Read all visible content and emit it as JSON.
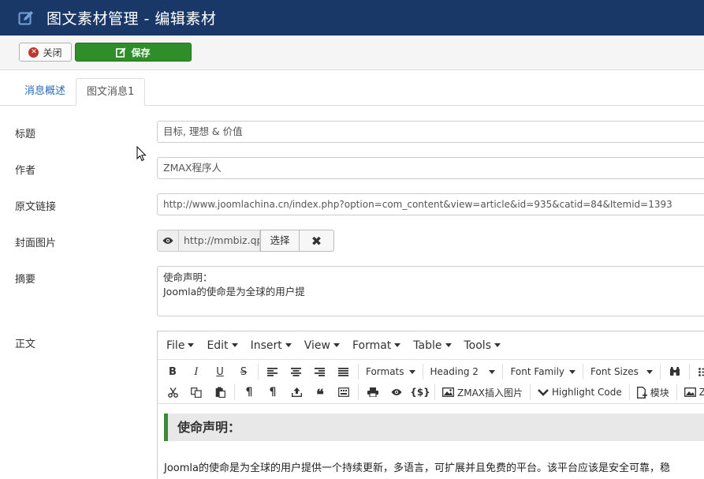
{
  "header": {
    "title": "图文素材管理 - 编辑素材",
    "icon": "edit-icon"
  },
  "toolbar": {
    "close_label": "关闭",
    "save_label": "保存"
  },
  "tabs": [
    {
      "label": "消息概述"
    },
    {
      "label": "图文消息1"
    }
  ],
  "form": {
    "title_label": "标题",
    "title_value": "目标, 理想 & 价值",
    "author_label": "作者",
    "author_value": "ZMAX程序人",
    "link_label": "原文链接",
    "link_value": "http://www.joomlachina.cn/index.php?option=com_content&view=article&id=935&catid=84&Itemid=1393",
    "cover_label": "封面图片",
    "cover_value": "http://mmbiz.qp",
    "cover_select": "选择",
    "summary_label": "摘要",
    "summary_lines": [
      "使命声明：",
      "Joomla的使命是为全球的用户提"
    ],
    "body_label": "正文"
  },
  "editor": {
    "menus": [
      "File",
      "Edit",
      "Insert",
      "View",
      "Format",
      "Table",
      "Tools"
    ],
    "dropdowns": {
      "formats": "Formats",
      "heading": "Heading 2",
      "font_family": "Font Family",
      "font_sizes": "Font Sizes"
    },
    "buttons": {
      "insert_image": "ZMAX插入图片",
      "highlight_code": "Highlight Code",
      "module": "模块",
      "cut_off": "Z"
    },
    "content": {
      "heading": "使命声明：",
      "paragraph": "Joomla的使命是为全球的用户提供一个持续更新，多语言，可扩展并且免费的平台。该平台应该是安全可靠，稳"
    }
  },
  "colors": {
    "header_bg": "#1a3867",
    "save_bg": "#2f8e2a",
    "close_icon": "#bd362f",
    "tab_link": "#2a69b8"
  }
}
